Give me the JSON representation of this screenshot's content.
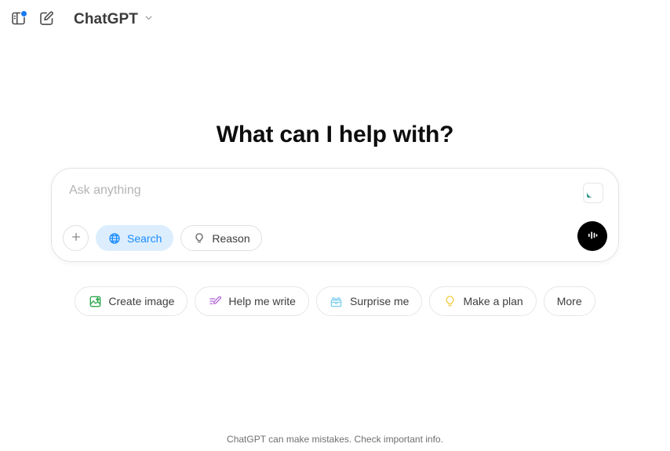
{
  "topbar": {
    "sidebar_toggle": {
      "icon": "sidebar-panel-icon",
      "has_notification_dot": true
    },
    "new_chat": {
      "icon": "compose-pencil-square-icon"
    },
    "brand_label": "ChatGPT",
    "brand_caret": "chevron-down-icon"
  },
  "main": {
    "headline": "What can I help with?"
  },
  "composer": {
    "placeholder": "Ask anything",
    "value": "",
    "grammarly": {
      "icon": "grammarly-icon",
      "color": "#0f8271"
    },
    "add_button": {
      "icon": "plus-icon",
      "label": ""
    },
    "tools": [
      {
        "label": "Search",
        "icon": "globe-icon",
        "active": true,
        "accent": "#1a8cff",
        "bg": "#dcedfd"
      },
      {
        "label": "Reason",
        "icon": "lightbulb-icon",
        "active": false,
        "accent": "#3d3d3d",
        "bg": "#ffffff"
      }
    ],
    "voice_button": {
      "icon": "voice-waveform-icon",
      "bg": "#000000"
    }
  },
  "suggestions": [
    {
      "label": "Create image",
      "icon": "image-icon",
      "color": "#2ea84f"
    },
    {
      "label": "Help me write",
      "icon": "pencil-lines-icon",
      "color": "#b870d8"
    },
    {
      "label": "Surprise me",
      "icon": "gift-box-icon",
      "color": "#7fd0f0"
    },
    {
      "label": "Make a plan",
      "icon": "lightbulb-icon",
      "color": "#f2ce4a"
    },
    {
      "label": "More",
      "icon": "",
      "color": ""
    }
  ],
  "footer": {
    "disclaimer": "ChatGPT can make mistakes. Check important info."
  }
}
